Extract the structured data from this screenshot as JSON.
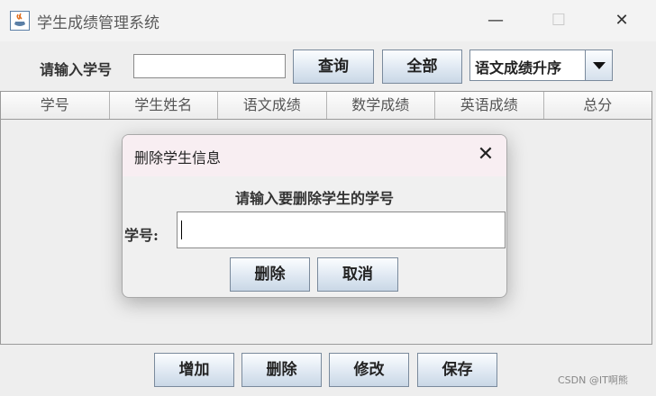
{
  "window": {
    "title": "学生成绩管理系统",
    "minimize_glyph": "—",
    "maximize_glyph": "☐",
    "close_glyph": "✕"
  },
  "toolbar": {
    "search_label": "请输入学号",
    "search_value": "",
    "query_label": "查询",
    "all_label": "全部",
    "sort_selected": "语文成绩升序"
  },
  "table": {
    "columns": [
      "学号",
      "学生姓名",
      "语文成绩",
      "数学成绩",
      "英语成绩",
      "总分"
    ]
  },
  "actions": {
    "add_label": "增加",
    "delete_label": "删除",
    "edit_label": "修改",
    "save_label": "保存"
  },
  "dialog": {
    "title": "删除学生信息",
    "close_glyph": "✕",
    "prompt": "请输入要删除学生的学号",
    "field_label": "学号:",
    "field_value": "",
    "delete_label": "删除",
    "cancel_label": "取消"
  },
  "watermark": "CSDN @IT啊熊",
  "icons": {
    "app": "java-coffee-icon",
    "dropdown": "triangle-down-icon"
  },
  "colors": {
    "button_top": "#fbfdff",
    "button_bottom": "#c9d7e6",
    "dialog_title_bg": "#f8eef2"
  }
}
